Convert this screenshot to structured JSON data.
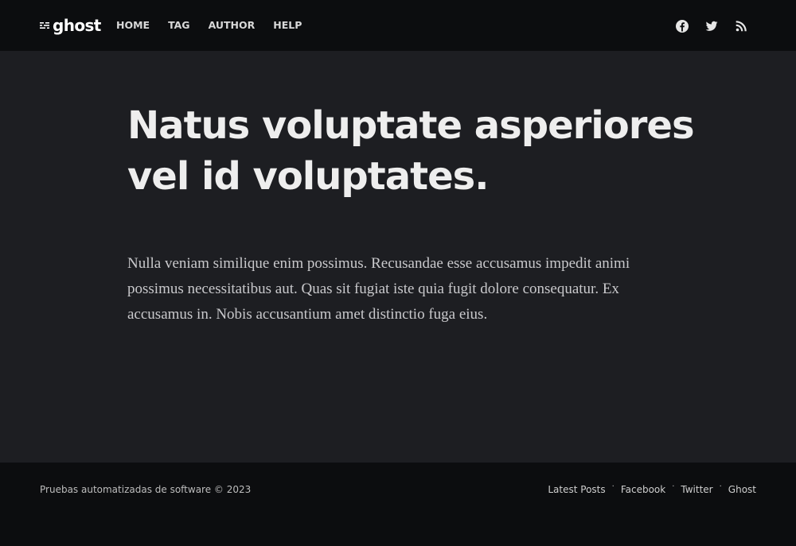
{
  "header": {
    "logo_text": "ghost",
    "nav": [
      {
        "label": "HOME"
      },
      {
        "label": "TAG"
      },
      {
        "label": "AUTHOR"
      },
      {
        "label": "HELP"
      }
    ],
    "social_icons": [
      "facebook-icon",
      "twitter-icon",
      "rss-icon"
    ]
  },
  "post": {
    "title_line1": "Natus voluptate asperiores",
    "title_line2": "vel id voluptates.",
    "body": "Nulla veniam similique enim possimus. Recusandae esse accusamus impedit animi possimus necessitatibus aut. Quas sit fugiat iste quia fugit dolore consequatur. Ex accusamus in. Nobis accusantium amet distinctio fuga eius."
  },
  "footer": {
    "copyright": "Pruebas automatizadas de software © 2023",
    "links": [
      {
        "label": "Latest Posts"
      },
      {
        "label": "Facebook"
      },
      {
        "label": "Twitter"
      },
      {
        "label": "Ghost"
      }
    ],
    "separator": "·"
  },
  "colors": {
    "nav_background": "#0c0d0f",
    "page_background": "#1d1e22",
    "title_text": "#eeeeee",
    "body_text": "#c9c9cc"
  }
}
